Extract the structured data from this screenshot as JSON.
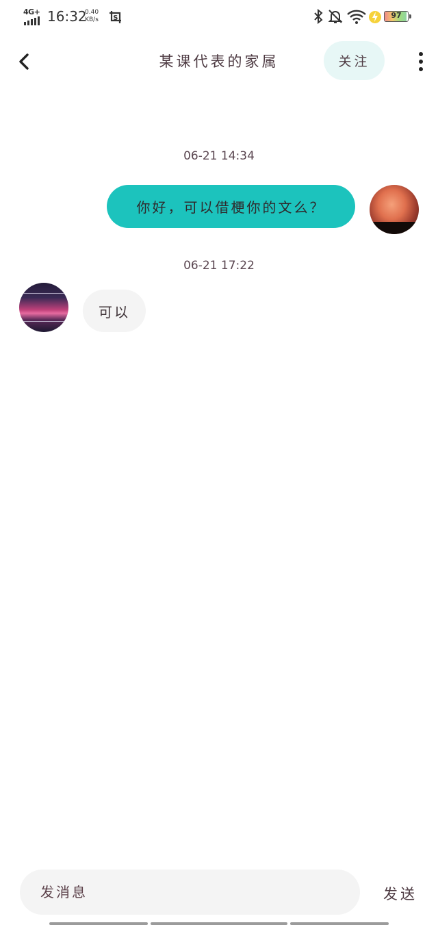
{
  "status_bar": {
    "network": "4G+",
    "time": "16:32",
    "speed_value": "0.40",
    "speed_unit": "KB/s",
    "battery": "97",
    "icons": [
      "screenshot-icon",
      "bluetooth-icon",
      "bell-off-icon",
      "wifi-icon",
      "charging-icon"
    ]
  },
  "header": {
    "title": "某课代表的家属",
    "follow_label": "关注"
  },
  "messages": [
    {
      "timestamp": "06-21 14:34",
      "from": "me",
      "text": "你好，可以借梗你的文么？"
    },
    {
      "timestamp": "06-21 17:22",
      "from": "other",
      "text": "可以"
    }
  ],
  "composer": {
    "placeholder": "发消息",
    "send_label": "发送"
  },
  "colors": {
    "accent": "#1cc3bd",
    "follow_bg": "#e7f7f6",
    "bubble_other": "#f4f4f4",
    "text": "#4d3a42"
  }
}
